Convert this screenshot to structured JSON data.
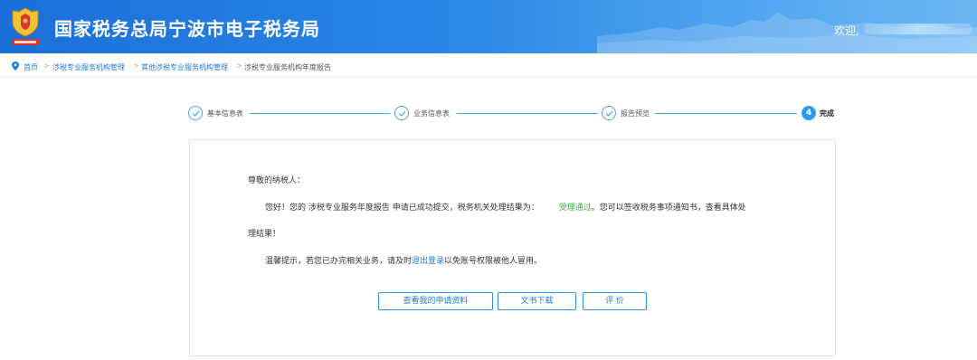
{
  "header": {
    "title": "国家税务总局宁波市电子税务局",
    "welcome": "欢迎,",
    "emblem_icon": "tax-emblem-icon"
  },
  "breadcrumb": {
    "items": [
      "首页",
      "涉税专业服务机构管理",
      "其他涉税专业服务机构管理",
      "涉税专业服务机构年度报告"
    ],
    "separator": ">"
  },
  "steps": [
    {
      "label": "基本信息表",
      "state": "done"
    },
    {
      "label": "业务信息表",
      "state": "done"
    },
    {
      "label": "报告预览",
      "state": "done"
    },
    {
      "label": "完成",
      "state": "active",
      "number": "4"
    }
  ],
  "message": {
    "greeting": "尊敬的纳税人：",
    "line1_prefix": "您好！您的 涉税专业服务年度报告 申请已成功提交，税务机关处理结果为：",
    "result": "受理通过",
    "line1_suffix": "。您可以签收税务事项通知书，查看具体处",
    "line2": "理结果！",
    "tip_prefix": "温馨提示，若您已办完相关业务，请及时",
    "logout_link": "退出登录",
    "tip_suffix": "以免账号权限被他人冒用。"
  },
  "buttons": {
    "view_application": "查看我的申请资料",
    "download_docs": "文书下载",
    "evaluate": "评 价"
  },
  "colors": {
    "header_blue": "#1a6fd9",
    "accent": "#2f9be9",
    "link": "#1f7ad1",
    "success": "#3bb14a"
  }
}
